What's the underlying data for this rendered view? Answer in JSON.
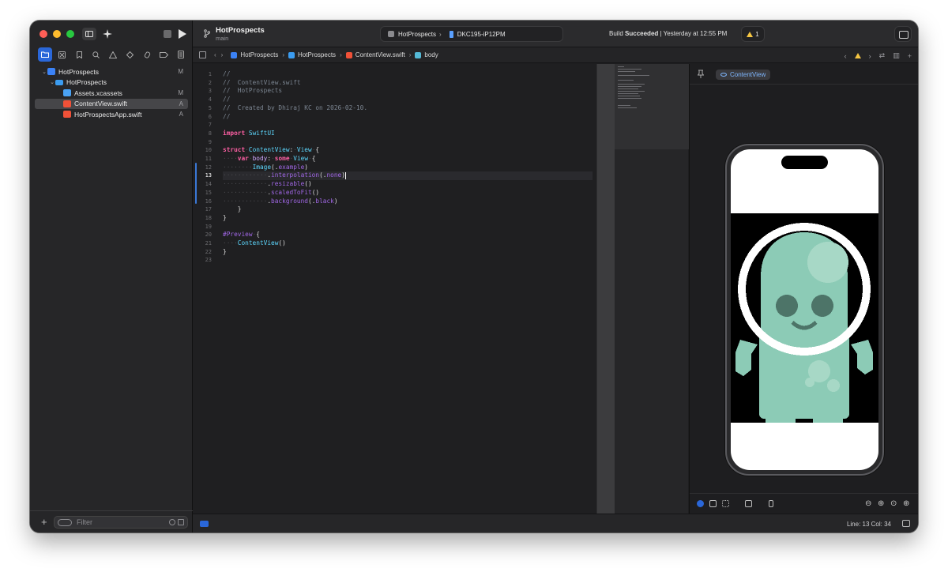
{
  "sidebar": {
    "tree": [
      {
        "label": "HotProspects",
        "status": "M",
        "kind": "project"
      },
      {
        "label": "HotProspects",
        "status": "",
        "kind": "folder"
      },
      {
        "label": "Assets.xcassets",
        "status": "M",
        "kind": "assets"
      },
      {
        "label": "ContentView.swift",
        "status": "A",
        "kind": "swift",
        "selected": true
      },
      {
        "label": "HotProspectsApp.swift",
        "status": "A",
        "kind": "swift"
      }
    ],
    "filter_placeholder": "Filter"
  },
  "toolbar": {
    "project": "HotProspects",
    "branch": "main",
    "scheme": "HotProspects",
    "device": "DKC195-iP12PM",
    "status_prefix": "Build",
    "status_bold": "Succeeded",
    "status_suffix": "| Yesterday at 12:55 PM",
    "warning_count": "1"
  },
  "jumpbar": {
    "crumbs": [
      "HotProspects",
      "HotProspects",
      "ContentView.swift",
      "body"
    ]
  },
  "editor": {
    "line_numbers": [
      "1",
      "2",
      "3",
      "4",
      "5",
      "6",
      "7",
      "8",
      "9",
      "10",
      "11",
      "12",
      "13",
      "14",
      "15",
      "16",
      "17",
      "18",
      "19",
      "20",
      "21",
      "22",
      "23"
    ],
    "current_line": 13,
    "lines": [
      "//",
      "//  ContentView.swift",
      "//  HotProspects",
      "//",
      "//  Created by Dhiraj KC on 2026-02-10.",
      "//",
      "",
      "import SwiftUI",
      "",
      "struct ContentView: View {",
      "    var body: some View {",
      "        Image(.example)",
      "            .interpolation(.none)",
      "            .resizable()",
      "            .scaledToFit()",
      "            .background(.black)",
      "    }",
      "}",
      "",
      "#Preview {",
      "    ContentView()",
      "}",
      ""
    ]
  },
  "canvas": {
    "preview_label": "ContentView"
  },
  "statusbar": {
    "line_col": "Line: 13  Col: 34"
  },
  "colors": {
    "accent": "#2a67d9",
    "keyword": "#fc5fa3",
    "type": "#5dd8ff",
    "function": "#a167e6",
    "comment": "#7b8591",
    "alien": "#8ccbb6"
  }
}
